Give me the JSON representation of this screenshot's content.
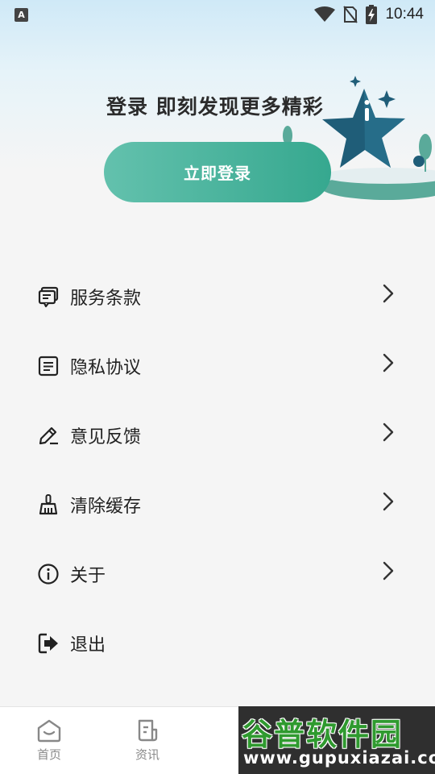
{
  "status_bar": {
    "app_badge": "A",
    "time": "10:44",
    "icons": [
      "wifi-icon",
      "no-sim-icon",
      "battery-charging-icon"
    ]
  },
  "hero": {
    "title": "登录 即刻发现更多精彩",
    "login_button": "立即登录"
  },
  "menu": {
    "items": [
      {
        "label": "服务条款",
        "icon": "chat-terms-icon",
        "chevron": true
      },
      {
        "label": "隐私协议",
        "icon": "document-icon",
        "chevron": true
      },
      {
        "label": "意见反馈",
        "icon": "pencil-icon",
        "chevron": true
      },
      {
        "label": "清除缓存",
        "icon": "broom-icon",
        "chevron": true
      },
      {
        "label": "关于",
        "icon": "info-icon",
        "chevron": true
      },
      {
        "label": "退出",
        "icon": "logout-icon",
        "chevron": false
      }
    ]
  },
  "tab_bar": {
    "tabs": [
      {
        "label": "首页",
        "icon": "home-icon"
      },
      {
        "label": "资讯",
        "icon": "news-icon"
      }
    ]
  },
  "watermark": {
    "name": "谷普软件园",
    "url": "www.gupuxiazai.com"
  },
  "colors": {
    "accent_start": "#63c1ad",
    "accent_end": "#36a88f",
    "star": "#1f5d78"
  }
}
